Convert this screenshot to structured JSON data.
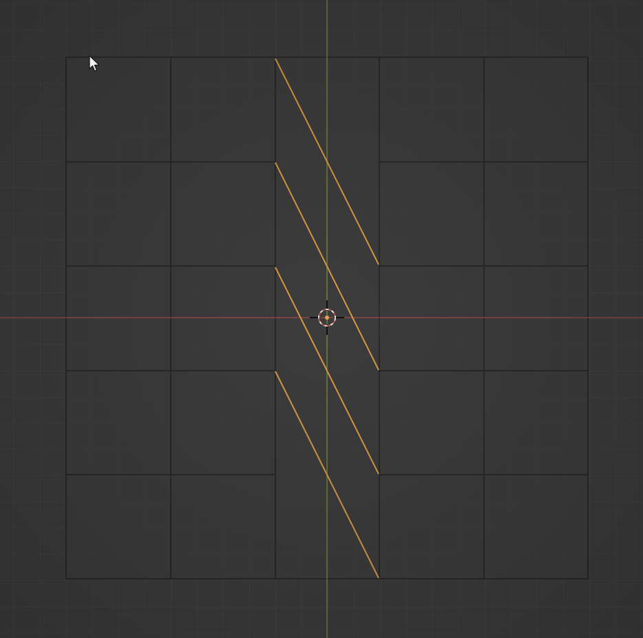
{
  "viewport": {
    "colors": {
      "background": "#3b3b3b",
      "grid_minor": "#444444",
      "grid_major": "#2a2a2a",
      "mesh_face": "#3f3f3f",
      "mesh_edge": "#222222",
      "selected_edge": "#d89a45",
      "axis_x": "#a34a4a",
      "axis_y": "#7a9440",
      "origin_cursor": "#d8a07a"
    },
    "icons": [
      "mouse-pointer-icon",
      "3d-cursor-icon",
      "origin-dot-icon"
    ]
  }
}
